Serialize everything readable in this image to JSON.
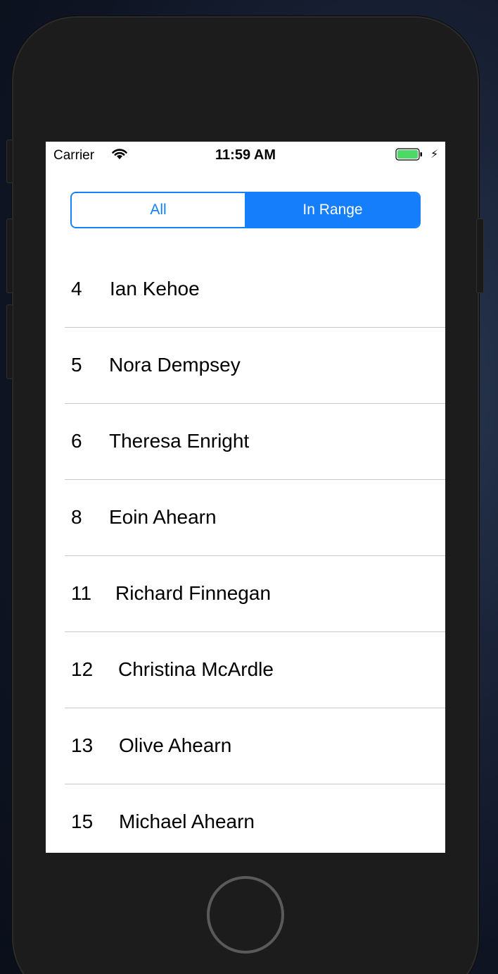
{
  "status_bar": {
    "carrier": "Carrier",
    "time": "11:59 AM",
    "battery_color": "#4cd964"
  },
  "segmented_control": {
    "segments": [
      {
        "label": "All",
        "selected": false
      },
      {
        "label": "In Range",
        "selected": true
      }
    ],
    "accent_color": "#147efb"
  },
  "list": {
    "rows": [
      {
        "number": "4",
        "name": "Ian Kehoe"
      },
      {
        "number": "5",
        "name": "Nora Dempsey"
      },
      {
        "number": "6",
        "name": "Theresa Enright"
      },
      {
        "number": "8",
        "name": "Eoin Ahearn"
      },
      {
        "number": "11",
        "name": "Richard Finnegan"
      },
      {
        "number": "12",
        "name": "Christina McArdle"
      },
      {
        "number": "13",
        "name": "Olive Ahearn"
      },
      {
        "number": "15",
        "name": "Michael Ahearn"
      }
    ]
  }
}
